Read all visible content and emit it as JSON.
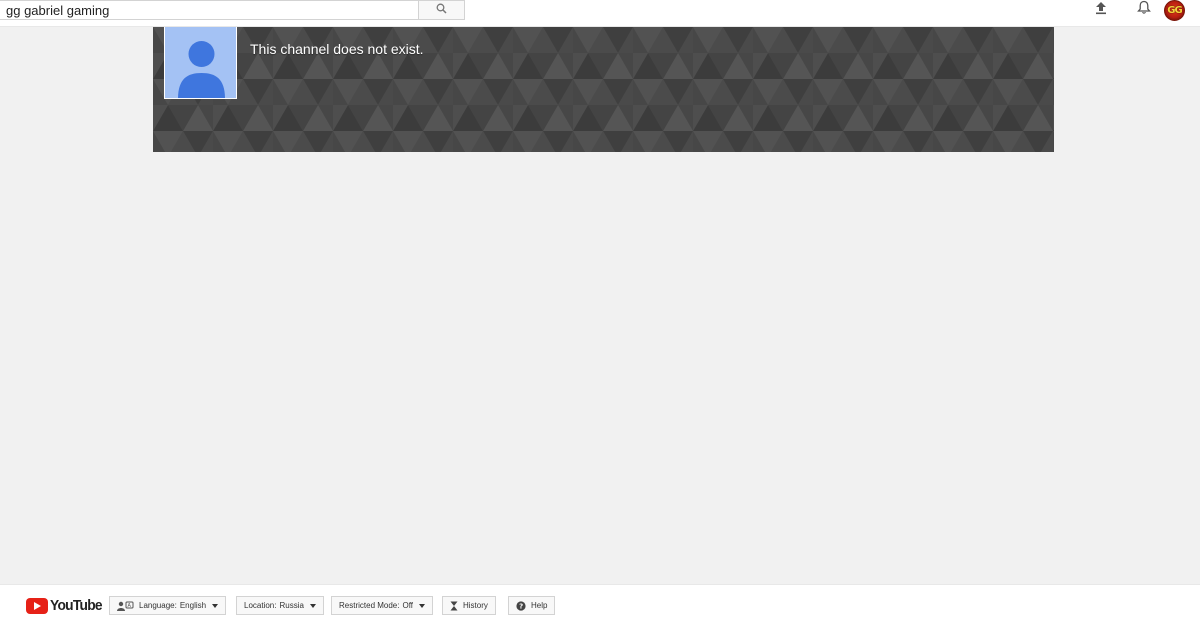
{
  "header": {
    "search": {
      "value": "gg gabriel gaming"
    },
    "icons": {
      "search": "search-icon",
      "upload": "upload-icon",
      "notifications": "bell-icon"
    },
    "avatar_initials": "GG"
  },
  "channel": {
    "message": "This channel does not exist."
  },
  "footer": {
    "logo_text": "YouTube",
    "language": {
      "label": "Language:",
      "value": "English"
    },
    "location": {
      "label": "Location:",
      "value": "Russia"
    },
    "restricted": {
      "label": "Restricted Mode:",
      "value": "Off"
    },
    "history": {
      "label": "History"
    },
    "help": {
      "label": "Help"
    }
  },
  "colors": {
    "page_bg": "#f1f1f1",
    "banner_bg": "#474747",
    "avatar_bg": "#a4c2f4",
    "avatar_figure": "#3f76de",
    "brand_red": "#e62117"
  }
}
